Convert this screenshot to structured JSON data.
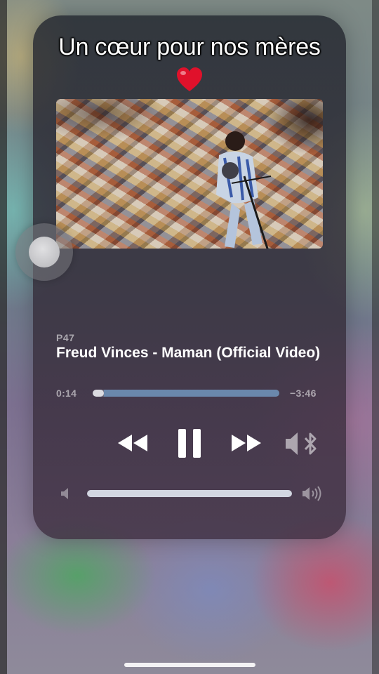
{
  "overlay": {
    "caption": "Un cœur pour nos mères",
    "emoji": "❤️"
  },
  "now_playing": {
    "source": "P47",
    "title": "Freud Vinces - Maman (Official Video)",
    "elapsed": "0:14",
    "remaining": "−3:46",
    "progress_fraction": 0.06
  },
  "controls": {
    "rewind_icon": "rewind-icon",
    "pause_icon": "pause-icon",
    "forward_icon": "fast-forward-icon",
    "output_icon": "speaker-bluetooth-icon"
  },
  "volume": {
    "level_fraction": 1.0,
    "low_icon": "volume-low-icon",
    "high_icon": "volume-high-icon"
  },
  "colors": {
    "accent_blue": "#69a0d2",
    "caption_text": "#ffffff"
  }
}
